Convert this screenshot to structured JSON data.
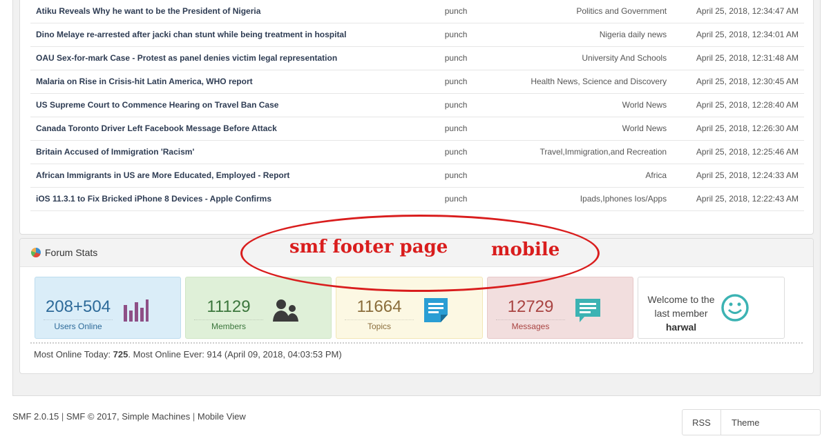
{
  "topics": [
    {
      "title": "Atiku Reveals Why he want to be the President of Nigeria",
      "poster": "punch",
      "board": "Politics and Government",
      "time": "April 25, 2018, 12:34:47 AM"
    },
    {
      "title": "Dino Melaye re-arrested after jacki chan stunt while being treatment in hospital",
      "poster": "punch",
      "board": "Nigeria daily news",
      "time": "April 25, 2018, 12:34:01 AM"
    },
    {
      "title": "OAU Sex-for-mark Case - Protest as panel denies victim legal representation",
      "poster": "punch",
      "board": "University And Schools",
      "time": "April 25, 2018, 12:31:48 AM"
    },
    {
      "title": "Malaria on Rise in Crisis-hit Latin America, WHO report",
      "poster": "punch",
      "board": "Health News, Science and Discovery",
      "time": "April 25, 2018, 12:30:45 AM"
    },
    {
      "title": "US Supreme Court to Commence Hearing on Travel Ban Case",
      "poster": "punch",
      "board": "World News",
      "time": "April 25, 2018, 12:28:40 AM"
    },
    {
      "title": "Canada Toronto Driver Left Facebook Message Before Attack",
      "poster": "punch",
      "board": "World News",
      "time": "April 25, 2018, 12:26:30 AM"
    },
    {
      "title": "Britain Accused of Immigration 'Racism'",
      "poster": "punch",
      "board": "Travel,Immigration,and Recreation",
      "time": "April 25, 2018, 12:25:46 AM"
    },
    {
      "title": "African Immigrants in US are More Educated, Employed - Report",
      "poster": "punch",
      "board": "Africa",
      "time": "April 25, 2018, 12:24:33 AM"
    },
    {
      "title": "iOS 11.3.1 to Fix Bricked iPhone 8 Devices - Apple Confirms",
      "poster": "punch",
      "board": "Ipads,Iphones Ios/Apps",
      "time": "April 25, 2018, 12:22:43 AM"
    }
  ],
  "stats": {
    "title": "Forum Stats",
    "title_icon": "pie-chart-icon",
    "users_online": {
      "value": "208+504",
      "label": "Users Online",
      "icon": "bar-chart-icon"
    },
    "members": {
      "value": "11129",
      "label": "Members",
      "icon": "users-icon"
    },
    "topics": {
      "value": "11664",
      "label": "Topics",
      "icon": "note-icon"
    },
    "messages": {
      "value": "12729",
      "label": "Messages",
      "icon": "chat-icon"
    },
    "welcome": {
      "line1": "Welcome to the",
      "line2": "last member",
      "member": "harwal",
      "icon": "smiley-icon"
    },
    "online_today_label": "Most Online Today:",
    "online_today_value": "725",
    "online_ever": ". Most Online Ever: 914 (April 09, 2018, 04:03:53 PM)"
  },
  "annotation": {
    "text1": "smf footer page",
    "text2": "mobile",
    "color": "#d91d1d"
  },
  "footer": {
    "version": "SMF 2.0.15",
    "copyright": "SMF © 2017, Simple Machines",
    "mobile_view": "Mobile View",
    "rss": "RSS",
    "theme": "Theme"
  }
}
